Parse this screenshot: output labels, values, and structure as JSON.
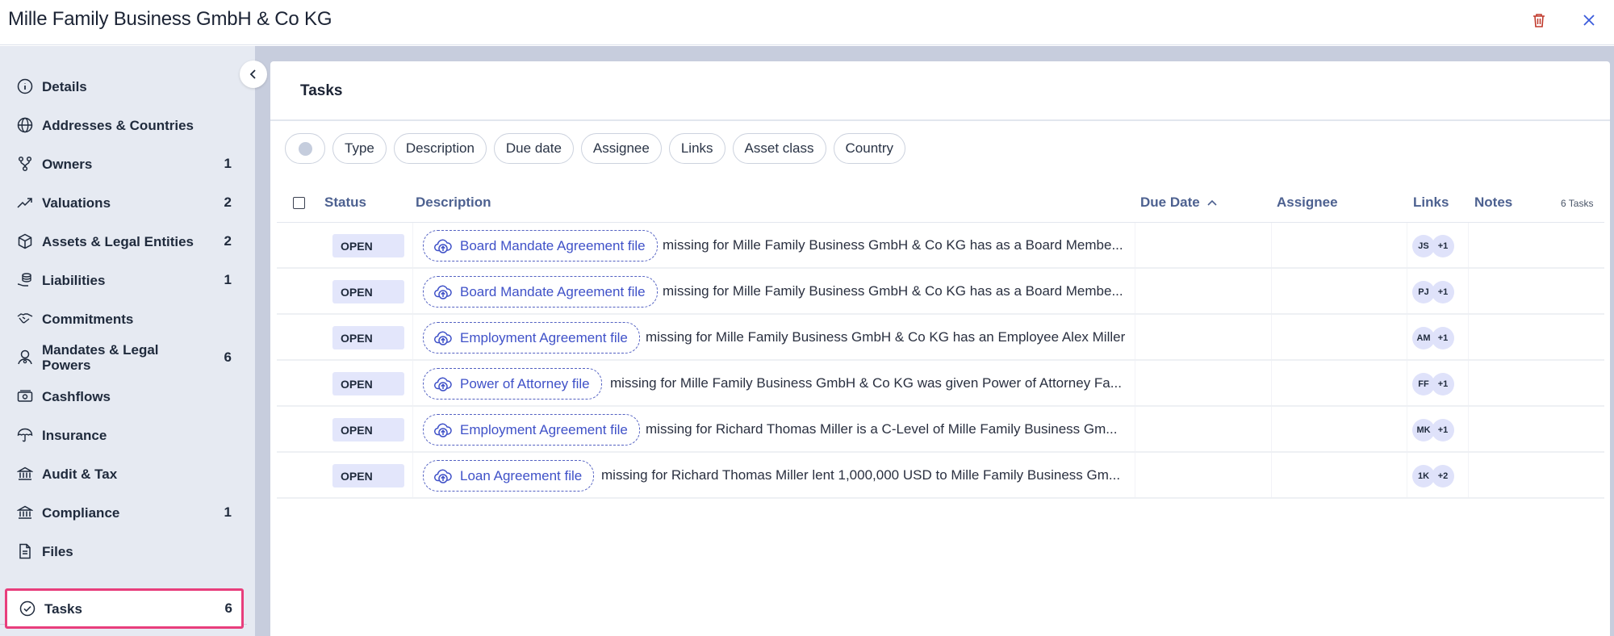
{
  "header": {
    "title": "Mille Family Business GmbH & Co KG",
    "delete_icon": "trash-icon",
    "close_icon": "close-icon"
  },
  "sidebar": {
    "collapse_icon": "chevron-left-icon",
    "items": [
      {
        "label": "Details",
        "count": "",
        "icon": "info-icon"
      },
      {
        "label": "Addresses & Countries",
        "count": "",
        "icon": "globe-icon"
      },
      {
        "label": "Owners",
        "count": "1",
        "icon": "fork-icon"
      },
      {
        "label": "Valuations",
        "count": "2",
        "icon": "trend-up-icon"
      },
      {
        "label": "Assets & Legal Entities",
        "count": "2",
        "icon": "package-icon"
      },
      {
        "label": "Liabilities",
        "count": "1",
        "icon": "coins-hand-icon"
      },
      {
        "label": "Commitments",
        "count": "",
        "icon": "handshake-icon"
      },
      {
        "label": "Mandates & Legal Powers",
        "count": "6",
        "icon": "person-badge-icon"
      },
      {
        "label": "Cashflows",
        "count": "",
        "icon": "banknote-icon"
      },
      {
        "label": "Insurance",
        "count": "",
        "icon": "umbrella-icon"
      },
      {
        "label": "Audit & Tax",
        "count": "",
        "icon": "bank-icon"
      },
      {
        "label": "Compliance",
        "count": "1",
        "icon": "bank-icon"
      },
      {
        "label": "Files",
        "count": "",
        "icon": "file-icon"
      }
    ],
    "active": {
      "label": "Tasks",
      "count": "6",
      "icon": "check-circle-icon"
    }
  },
  "panel": {
    "title": "Tasks",
    "filters": [
      "Type",
      "Description",
      "Due date",
      "Assignee",
      "Links",
      "Asset class",
      "Country"
    ],
    "columns": {
      "status": "Status",
      "description": "Description",
      "due_date": "Due Date",
      "assignee": "Assignee",
      "links": "Links",
      "notes": "Notes",
      "count": "6 Tasks"
    },
    "sort_icon": "chevron-up-icon",
    "rows": [
      {
        "status": "OPEN",
        "file": "Board Mandate Agreement file",
        "text": "missing for Mille Family Business GmbH & Co KG has as a Board Membe...",
        "links": [
          "JS",
          "+1"
        ]
      },
      {
        "status": "OPEN",
        "file": "Board Mandate Agreement file",
        "text": "missing for Mille Family Business GmbH & Co KG has as a Board Membe...",
        "links": [
          "PJ",
          "+1"
        ]
      },
      {
        "status": "OPEN",
        "file": "Employment Agreement file",
        "text": "missing for Mille Family Business GmbH & Co KG has an Employee Alex Miller",
        "links": [
          "AM",
          "+1"
        ]
      },
      {
        "status": "OPEN",
        "file": "Power of Attorney file",
        "text": "missing for Mille Family Business GmbH & Co KG was given Power of Attorney Fa...",
        "links": [
          "FF",
          "+1"
        ]
      },
      {
        "status": "OPEN",
        "file": "Employment Agreement file",
        "text": "missing for Richard Thomas Miller is a C-Level of Mille Family Business Gm...",
        "links": [
          "MK",
          "+1"
        ]
      },
      {
        "status": "OPEN",
        "file": "Loan Agreement file",
        "text": "missing for Richard Thomas Miller lent 1,000,000 USD to Mille Family Business Gm...",
        "links": [
          "1K",
          "+2"
        ]
      }
    ]
  },
  "colors": {
    "accent": "#3f51c8",
    "active_outline": "#e83e7c",
    "status_bg": "#e3e6fb",
    "sidebar_bg": "#e6eaf2",
    "delete": "#c0392b"
  }
}
